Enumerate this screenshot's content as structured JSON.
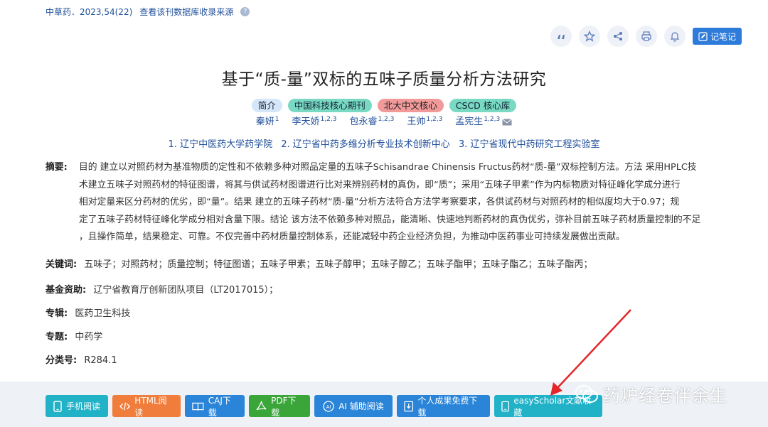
{
  "source": {
    "journal_issue": "中草药．2023,54(22)",
    "db_link": "查看该刊数据库收录来源",
    "help": "?"
  },
  "toolbar": {
    "note_label": "记笔记"
  },
  "article": {
    "title": "基于“质-量”双标的五味子质量分析方法研究",
    "badges": [
      "简介",
      "中国科技核心期刊",
      "北大中文核心",
      "CSCD 核心库"
    ],
    "authors": [
      {
        "name": "秦妍",
        "sup": "1"
      },
      {
        "name": "李天娇",
        "sup": "1,2,3"
      },
      {
        "name": "包永睿",
        "sup": "1,2,3"
      },
      {
        "name": "王帅",
        "sup": "1,2,3"
      },
      {
        "name": "孟宪生",
        "sup": "1,2,3"
      }
    ],
    "orgs": [
      "1. 辽宁中医药大学药学院",
      "2. 辽宁省中药多维分析专业技术创新中心",
      "3. 辽宁省现代中药研究工程实验室"
    ],
    "abstract_label": "摘要:",
    "abstract_lines": [
      "目的 建立以对照药材为基准物质的定性和不依赖多种对照品定量的五味子Schisandrae Chinensis Fructus药材“质-量”双标控制方法。方法 采用HPLC技",
      "术建立五味子对照药材的特征图谱，将其与供试药材图谱进行比对来辨别药材的真伪，即“质”；采用“五味子甲素”作为内标物质对特征峰化学成分进行",
      "相对定量来区分药材的优劣，即“量”。结果 建立的五味子药材“质-量”分析方法符合方法学考察要求，各供试药材与对照药材的相似度均大于0.97；规",
      "定了五味子药材特征峰化学成分相对含量下限。结论 该方法不依赖多种对照品，能清晰、快速地判断药材的真伪优劣，弥补目前五味子药材质量控制的不足",
      "，且操作简单，结果稳定、可靠。不仅完善中药材质量控制体系，还能减轻中药企业经济负担，为推动中医药事业可持续发展做出贡献。"
    ],
    "keywords_label": "关键词:",
    "keywords": "五味子；对照药材；质量控制；特征图谱；五味子甲素；五味子醇甲；五味子醇乙；五味子酯甲；五味子酯乙；五味子酯丙；",
    "fund_label": "基金资助:",
    "fund": "辽宁省教育厅创新团队项目（LT2017015）；",
    "series_label": "专辑:",
    "series": "医药卫生科技",
    "topic_label": "专题:",
    "topic": "中药学",
    "class_label": "分类号:",
    "class": "R284.1"
  },
  "buttons": [
    {
      "label": "手机阅读",
      "color": "#21b2c8",
      "icon": "phone-icon"
    },
    {
      "label": "HTML阅读",
      "color": "#f07d3c",
      "icon": "code-icon"
    },
    {
      "label": "CAJ下载",
      "color": "#2a84d8",
      "icon": "book-icon"
    },
    {
      "label": "PDF下载",
      "color": "#3aa63a",
      "icon": "pdf-icon"
    },
    {
      "label": "AI 辅助阅读",
      "color": "#2a84d8",
      "icon": "ai-icon"
    },
    {
      "label": "个人成果免费下载",
      "color": "#2a84d8",
      "icon": "download-icon"
    },
    {
      "label": "easyScholar文献收藏",
      "color": "#21b2c8",
      "icon": "phone-icon"
    }
  ],
  "watermark": {
    "text": "药炉经卷伴余生"
  }
}
